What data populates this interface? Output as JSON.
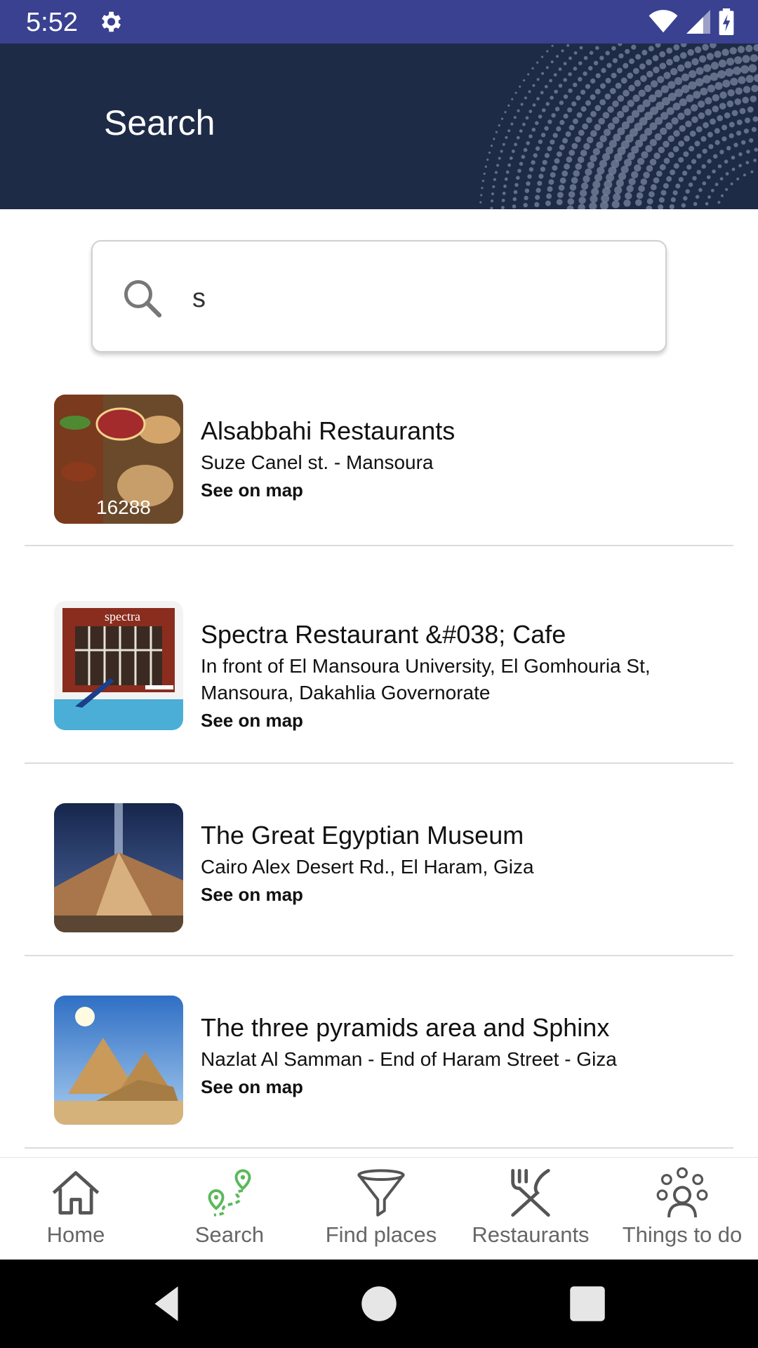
{
  "status_bar": {
    "time": "5:52"
  },
  "header": {
    "title": "Search"
  },
  "search": {
    "value": "s",
    "placeholder": ""
  },
  "results": [
    {
      "name": "Alsabbahi Restaurants",
      "address": "Suze Canel st. - Mansoura",
      "link": "See on map",
      "thumb_text": "16288"
    },
    {
      "name": "Spectra Restaurant &#038; Cafe",
      "address_line1": "In front of El Mansoura University, El Gomhouria St,",
      "address_line2": "Mansoura, Dakahlia Governorate",
      "link": "See on map",
      "thumb_text": "spectra"
    },
    {
      "name": "The Great Egyptian Museum",
      "address": "Cairo Alex Desert Rd., El Haram, Giza",
      "link": "See on map"
    },
    {
      "name": "The three pyramids area and Sphinx",
      "address": "Nazlat Al Samman - End of Haram Street - Giza",
      "link": "See on map"
    }
  ],
  "bottom_nav": {
    "items": [
      {
        "label": "Home",
        "icon": "home-icon"
      },
      {
        "label": "Search",
        "icon": "route-pin-icon"
      },
      {
        "label": "Find places",
        "icon": "funnel-icon"
      },
      {
        "label": "Restaurants",
        "icon": "fork-knife-icon"
      },
      {
        "label": "Things to do",
        "icon": "ideas-person-icon"
      }
    ],
    "active_index": 1
  },
  "colors": {
    "status_bar": "#3a4191",
    "header": "#1e2b47",
    "active_icon": "#5cb85c"
  }
}
